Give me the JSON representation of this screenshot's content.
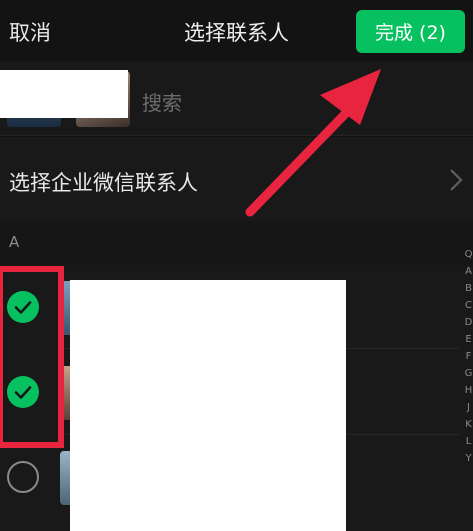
{
  "navbar": {
    "cancel_label": "取消",
    "title": "选择联系人",
    "done_label": "完成 (2)",
    "done_color": "#07c160"
  },
  "search": {
    "placeholder": "搜索",
    "icon": "search-icon"
  },
  "enterprise": {
    "label": "选择企业微信联系人",
    "icon": "chevron-right-icon"
  },
  "section": {
    "letter": "A"
  },
  "contacts": [
    {
      "checked": true
    },
    {
      "checked": true
    },
    {
      "checked": false
    }
  ],
  "index_letters": [
    "Q",
    "A",
    "B",
    "C",
    "D",
    "E",
    "F",
    "G",
    "H",
    "J",
    "K",
    "L",
    "Y"
  ],
  "annotation": {
    "color": "#e8243f"
  }
}
